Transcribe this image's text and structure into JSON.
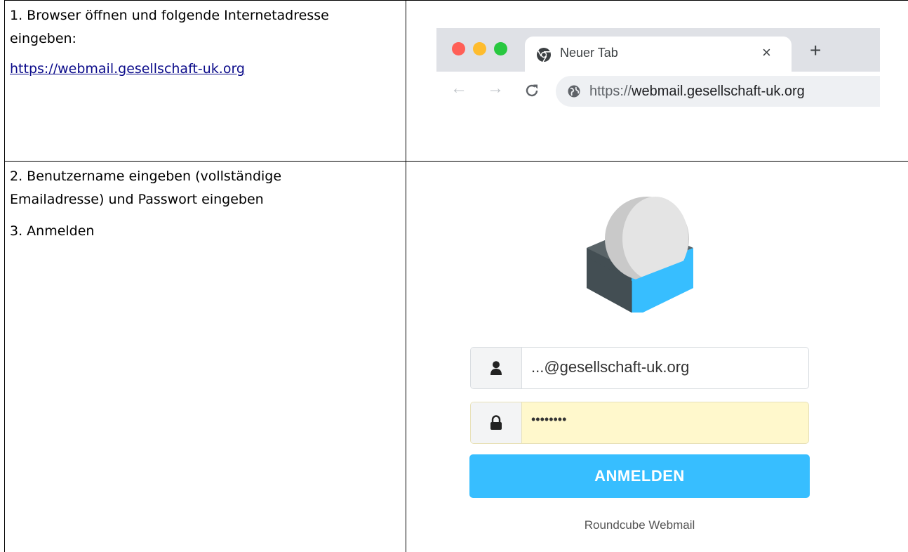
{
  "steps": {
    "step1": {
      "text": "1. Browser öffnen und folgende Internetadresse eingeben:",
      "link": "https://webmail.gesellschaft-uk.org"
    },
    "step2": {
      "text": "2. Benutzername eingeben (vollständige Emailadresse) und Passwort eingeben"
    },
    "step3": {
      "text": "3. Anmelden"
    }
  },
  "browser": {
    "tab_title": "Neuer Tab",
    "tab_close": "×",
    "new_tab": "+",
    "url_scheme": "https://",
    "url_host": "webmail.gesellschaft-uk.org",
    "icons": [
      "chrome-icon",
      "back-arrow-icon",
      "forward-arrow-icon",
      "reload-icon",
      "globe-icon"
    ],
    "colors": {
      "red": "#ff5f57",
      "yellow": "#febc2e",
      "green": "#28c840",
      "chrome_bg": "#dfe1e6"
    }
  },
  "login": {
    "username_value": "...@gesellschaft-uk.org",
    "password_value": "••••••••",
    "button_label": "ANMELDEN",
    "footer": "Roundcube Webmail",
    "icons": [
      "roundcube-logo-icon",
      "user-icon",
      "lock-icon"
    ],
    "colors": {
      "accent": "#37beff",
      "password_bg": "#fff8cc",
      "logo_dark": "#434e53"
    }
  }
}
